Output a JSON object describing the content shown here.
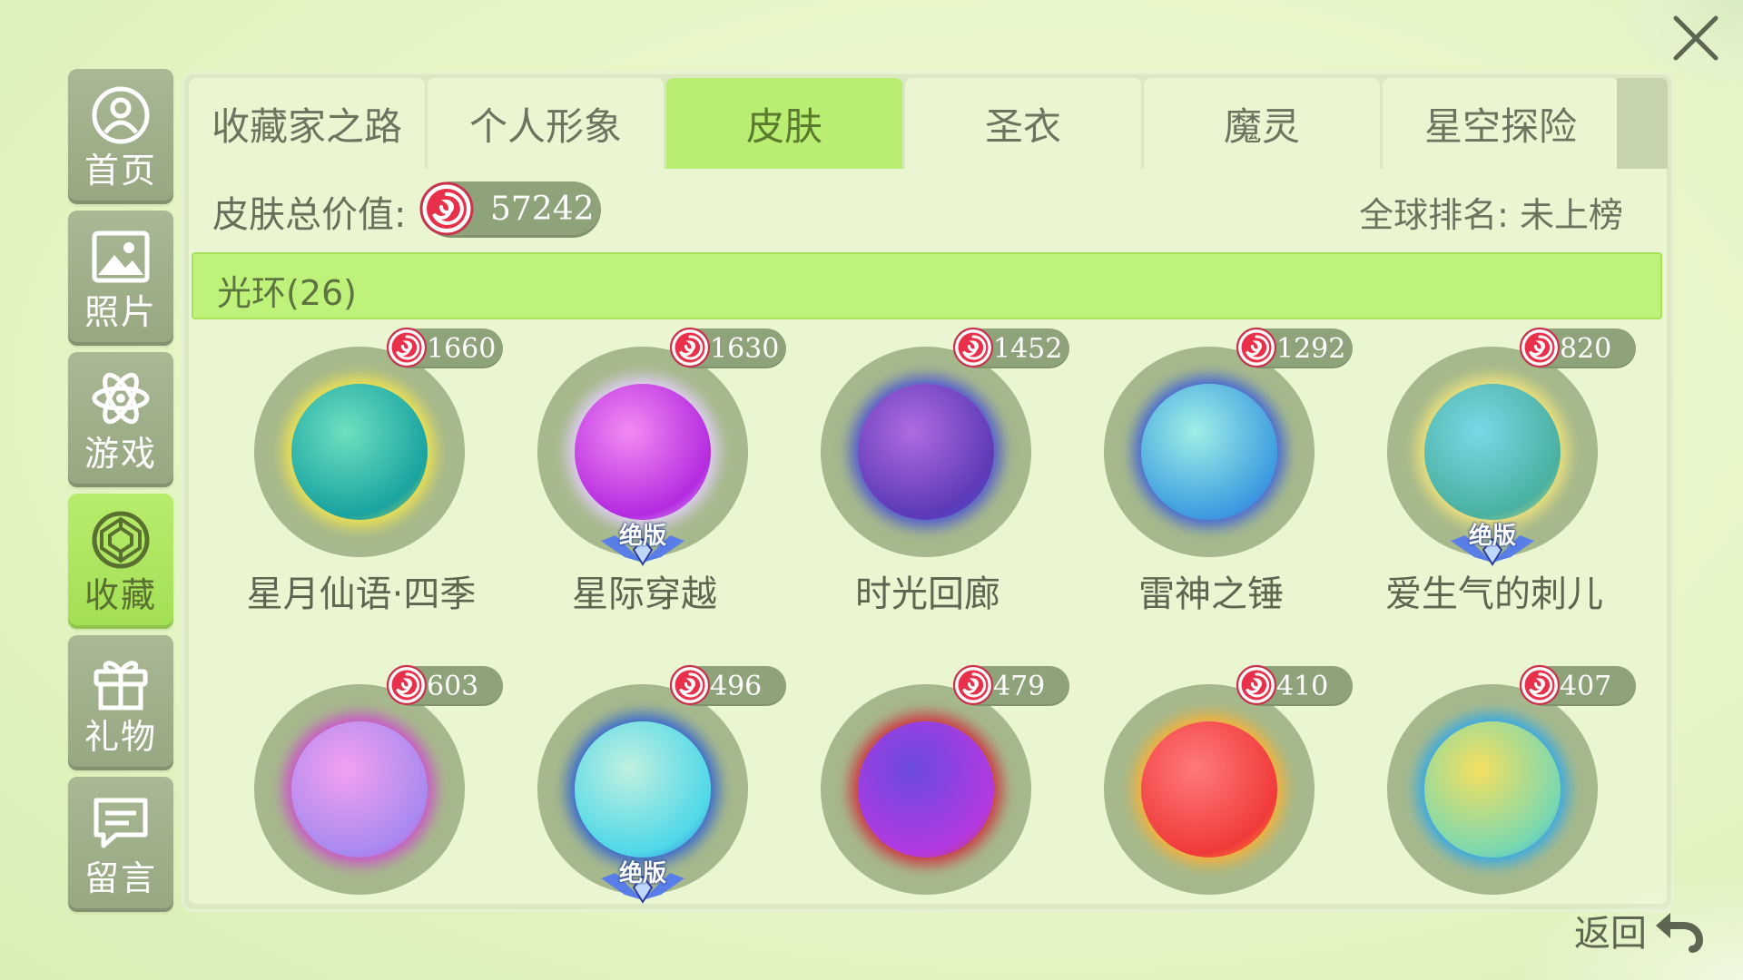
{
  "sidebar": {
    "items": [
      {
        "label": "首页",
        "icon": "home-user-icon"
      },
      {
        "label": "照片",
        "icon": "photo-icon"
      },
      {
        "label": "游戏",
        "icon": "atom-game-icon"
      },
      {
        "label": "收藏",
        "icon": "collection-gem-icon",
        "active": true
      },
      {
        "label": "礼物",
        "icon": "gift-icon"
      },
      {
        "label": "留言",
        "icon": "message-icon"
      }
    ]
  },
  "tabs": [
    {
      "label": "收藏家之路"
    },
    {
      "label": "个人形象"
    },
    {
      "label": "皮肤",
      "active": true
    },
    {
      "label": "圣衣"
    },
    {
      "label": "魔灵"
    },
    {
      "label": "星空探险"
    }
  ],
  "summary": {
    "value_label": "皮肤总价值:",
    "value_amount": "57242",
    "rank_text": "全球排名: 未上榜"
  },
  "section": {
    "title": "光环(26)"
  },
  "items": [
    {
      "price": "1660",
      "name": "星月仙语·四季",
      "badge": "",
      "colors": [
        "#6ee0c0",
        "#1aa3a0",
        "#f5e64a"
      ]
    },
    {
      "price": "1630",
      "name": "星际穿越",
      "badge": "绝版",
      "colors": [
        "#f28bf2",
        "#b42be0",
        "#e6d0ff"
      ]
    },
    {
      "price": "1452",
      "name": "时光回廊",
      "badge": "",
      "colors": [
        "#b06be0",
        "#5c3ab8",
        "#4a52d8"
      ]
    },
    {
      "price": "1292",
      "name": "雷神之锤",
      "badge": "",
      "colors": [
        "#9ff0e6",
        "#3f9de0",
        "#3a5fe0"
      ]
    },
    {
      "price": "820",
      "name": "爱生气的刺儿",
      "badge": "绝版",
      "colors": [
        "#7ad8e8",
        "#4ab0a0",
        "#f5e67a"
      ]
    },
    {
      "price": "603",
      "name": "",
      "badge": "",
      "colors": [
        "#f3a0f0",
        "#a98af0",
        "#d04ad0"
      ]
    },
    {
      "price": "496",
      "name": "",
      "badge": "绝版",
      "colors": [
        "#c0f0e0",
        "#4fd8e8",
        "#2a5fd8"
      ]
    },
    {
      "price": "479",
      "name": "",
      "badge": "",
      "colors": [
        "#6a4ae0",
        "#b43ae0",
        "#d02a3a"
      ]
    },
    {
      "price": "410",
      "name": "",
      "badge": "",
      "colors": [
        "#ff7a7a",
        "#f03a3a",
        "#ffb030"
      ]
    },
    {
      "price": "407",
      "name": "",
      "badge": "",
      "colors": [
        "#f5e060",
        "#7ad8b0",
        "#2aa8f0"
      ]
    }
  ],
  "back": {
    "label": "返回"
  },
  "colors": {
    "active_green": "#b9ee72",
    "coin_red": "#e8304a",
    "pill_gray_green": "#8fa37b"
  }
}
